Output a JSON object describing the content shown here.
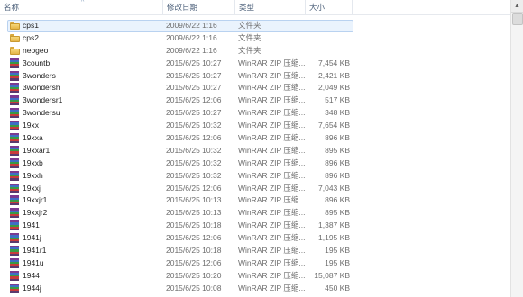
{
  "columns": {
    "name": "名称",
    "date": "修改日期",
    "type": "类型",
    "size": "大小"
  },
  "rows": [
    {
      "icon": "folder-icon",
      "name": "cps1",
      "date": "2009/6/22 1:16",
      "type": "文件夹",
      "size": "",
      "selected": true
    },
    {
      "icon": "folder-icon",
      "name": "cps2",
      "date": "2009/6/22 1:16",
      "type": "文件夹",
      "size": ""
    },
    {
      "icon": "folder-icon",
      "name": "neogeo",
      "date": "2009/6/22 1:16",
      "type": "文件夹",
      "size": ""
    },
    {
      "icon": "rar-archive-icon",
      "name": "3countb",
      "date": "2015/6/25 10:27",
      "type": "WinRAR ZIP 压缩...",
      "size": "7,454 KB"
    },
    {
      "icon": "rar-archive-icon",
      "name": "3wonders",
      "date": "2015/6/25 10:27",
      "type": "WinRAR ZIP 压缩...",
      "size": "2,421 KB"
    },
    {
      "icon": "rar-archive-icon",
      "name": "3wondersh",
      "date": "2015/6/25 10:27",
      "type": "WinRAR ZIP 压缩...",
      "size": "2,049 KB"
    },
    {
      "icon": "rar-archive-icon",
      "name": "3wondersr1",
      "date": "2015/6/25 12:06",
      "type": "WinRAR ZIP 压缩...",
      "size": "517 KB"
    },
    {
      "icon": "rar-archive-icon",
      "name": "3wondersu",
      "date": "2015/6/25 10:27",
      "type": "WinRAR ZIP 压缩...",
      "size": "348 KB"
    },
    {
      "icon": "rar-archive-icon",
      "name": "19xx",
      "date": "2015/6/25 10:32",
      "type": "WinRAR ZIP 压缩...",
      "size": "7,654 KB"
    },
    {
      "icon": "rar-archive-icon",
      "name": "19xxa",
      "date": "2015/6/25 12:06",
      "type": "WinRAR ZIP 压缩...",
      "size": "896 KB"
    },
    {
      "icon": "rar-archive-icon",
      "name": "19xxar1",
      "date": "2015/6/25 10:32",
      "type": "WinRAR ZIP 压缩...",
      "size": "895 KB"
    },
    {
      "icon": "rar-archive-icon",
      "name": "19xxb",
      "date": "2015/6/25 10:32",
      "type": "WinRAR ZIP 压缩...",
      "size": "896 KB"
    },
    {
      "icon": "rar-archive-icon",
      "name": "19xxh",
      "date": "2015/6/25 10:32",
      "type": "WinRAR ZIP 压缩...",
      "size": "896 KB"
    },
    {
      "icon": "rar-archive-icon",
      "name": "19xxj",
      "date": "2015/6/25 12:06",
      "type": "WinRAR ZIP 压缩...",
      "size": "7,043 KB"
    },
    {
      "icon": "rar-archive-icon",
      "name": "19xxjr1",
      "date": "2015/6/25 10:13",
      "type": "WinRAR ZIP 压缩...",
      "size": "896 KB"
    },
    {
      "icon": "rar-archive-icon",
      "name": "19xxjr2",
      "date": "2015/6/25 10:13",
      "type": "WinRAR ZIP 压缩...",
      "size": "895 KB"
    },
    {
      "icon": "rar-archive-icon",
      "name": "1941",
      "date": "2015/6/25 10:18",
      "type": "WinRAR ZIP 压缩...",
      "size": "1,387 KB"
    },
    {
      "icon": "rar-archive-icon",
      "name": "1941j",
      "date": "2015/6/25 12:06",
      "type": "WinRAR ZIP 压缩...",
      "size": "1,195 KB"
    },
    {
      "icon": "rar-archive-icon",
      "name": "1941r1",
      "date": "2015/6/25 10:18",
      "type": "WinRAR ZIP 压缩...",
      "size": "195 KB"
    },
    {
      "icon": "rar-archive-icon",
      "name": "1941u",
      "date": "2015/6/25 12:06",
      "type": "WinRAR ZIP 压缩...",
      "size": "195 KB"
    },
    {
      "icon": "rar-archive-icon",
      "name": "1944",
      "date": "2015/6/25 10:20",
      "type": "WinRAR ZIP 压缩...",
      "size": "15,087 KB"
    },
    {
      "icon": "rar-archive-icon",
      "name": "1944j",
      "date": "2015/6/25 10:08",
      "type": "WinRAR ZIP 压缩...",
      "size": "450 KB"
    }
  ],
  "scrollbar": {
    "up_arrow": "▲"
  }
}
